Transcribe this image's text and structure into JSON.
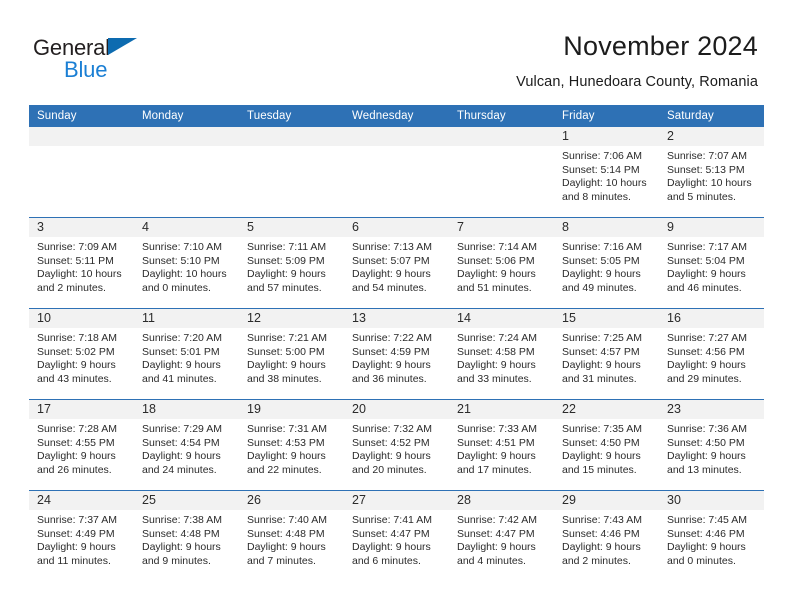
{
  "brand": {
    "name_part1": "General",
    "name_part2": "Blue",
    "triangle_color": "#0d6bb0",
    "blue_text_color": "#1b7fd4"
  },
  "header": {
    "title": "November 2024",
    "subtitle": "Vulcan, Hunedoara County, Romania"
  },
  "theme": {
    "header_blue": "#2e71b5",
    "daynum_band": "#f2f2f2",
    "text": "#2b2b2b"
  },
  "calendar": {
    "weekday_headers": [
      "Sunday",
      "Monday",
      "Tuesday",
      "Wednesday",
      "Thursday",
      "Friday",
      "Saturday"
    ],
    "weeks": [
      [
        {
          "day": "",
          "sunrise": "",
          "sunset": "",
          "daylight1": "",
          "daylight2": ""
        },
        {
          "day": "",
          "sunrise": "",
          "sunset": "",
          "daylight1": "",
          "daylight2": ""
        },
        {
          "day": "",
          "sunrise": "",
          "sunset": "",
          "daylight1": "",
          "daylight2": ""
        },
        {
          "day": "",
          "sunrise": "",
          "sunset": "",
          "daylight1": "",
          "daylight2": ""
        },
        {
          "day": "",
          "sunrise": "",
          "sunset": "",
          "daylight1": "",
          "daylight2": ""
        },
        {
          "day": "1",
          "sunrise": "Sunrise: 7:06 AM",
          "sunset": "Sunset: 5:14 PM",
          "daylight1": "Daylight: 10 hours",
          "daylight2": "and 8 minutes."
        },
        {
          "day": "2",
          "sunrise": "Sunrise: 7:07 AM",
          "sunset": "Sunset: 5:13 PM",
          "daylight1": "Daylight: 10 hours",
          "daylight2": "and 5 minutes."
        }
      ],
      [
        {
          "day": "3",
          "sunrise": "Sunrise: 7:09 AM",
          "sunset": "Sunset: 5:11 PM",
          "daylight1": "Daylight: 10 hours",
          "daylight2": "and 2 minutes."
        },
        {
          "day": "4",
          "sunrise": "Sunrise: 7:10 AM",
          "sunset": "Sunset: 5:10 PM",
          "daylight1": "Daylight: 10 hours",
          "daylight2": "and 0 minutes."
        },
        {
          "day": "5",
          "sunrise": "Sunrise: 7:11 AM",
          "sunset": "Sunset: 5:09 PM",
          "daylight1": "Daylight: 9 hours",
          "daylight2": "and 57 minutes."
        },
        {
          "day": "6",
          "sunrise": "Sunrise: 7:13 AM",
          "sunset": "Sunset: 5:07 PM",
          "daylight1": "Daylight: 9 hours",
          "daylight2": "and 54 minutes."
        },
        {
          "day": "7",
          "sunrise": "Sunrise: 7:14 AM",
          "sunset": "Sunset: 5:06 PM",
          "daylight1": "Daylight: 9 hours",
          "daylight2": "and 51 minutes."
        },
        {
          "day": "8",
          "sunrise": "Sunrise: 7:16 AM",
          "sunset": "Sunset: 5:05 PM",
          "daylight1": "Daylight: 9 hours",
          "daylight2": "and 49 minutes."
        },
        {
          "day": "9",
          "sunrise": "Sunrise: 7:17 AM",
          "sunset": "Sunset: 5:04 PM",
          "daylight1": "Daylight: 9 hours",
          "daylight2": "and 46 minutes."
        }
      ],
      [
        {
          "day": "10",
          "sunrise": "Sunrise: 7:18 AM",
          "sunset": "Sunset: 5:02 PM",
          "daylight1": "Daylight: 9 hours",
          "daylight2": "and 43 minutes."
        },
        {
          "day": "11",
          "sunrise": "Sunrise: 7:20 AM",
          "sunset": "Sunset: 5:01 PM",
          "daylight1": "Daylight: 9 hours",
          "daylight2": "and 41 minutes."
        },
        {
          "day": "12",
          "sunrise": "Sunrise: 7:21 AM",
          "sunset": "Sunset: 5:00 PM",
          "daylight1": "Daylight: 9 hours",
          "daylight2": "and 38 minutes."
        },
        {
          "day": "13",
          "sunrise": "Sunrise: 7:22 AM",
          "sunset": "Sunset: 4:59 PM",
          "daylight1": "Daylight: 9 hours",
          "daylight2": "and 36 minutes."
        },
        {
          "day": "14",
          "sunrise": "Sunrise: 7:24 AM",
          "sunset": "Sunset: 4:58 PM",
          "daylight1": "Daylight: 9 hours",
          "daylight2": "and 33 minutes."
        },
        {
          "day": "15",
          "sunrise": "Sunrise: 7:25 AM",
          "sunset": "Sunset: 4:57 PM",
          "daylight1": "Daylight: 9 hours",
          "daylight2": "and 31 minutes."
        },
        {
          "day": "16",
          "sunrise": "Sunrise: 7:27 AM",
          "sunset": "Sunset: 4:56 PM",
          "daylight1": "Daylight: 9 hours",
          "daylight2": "and 29 minutes."
        }
      ],
      [
        {
          "day": "17",
          "sunrise": "Sunrise: 7:28 AM",
          "sunset": "Sunset: 4:55 PM",
          "daylight1": "Daylight: 9 hours",
          "daylight2": "and 26 minutes."
        },
        {
          "day": "18",
          "sunrise": "Sunrise: 7:29 AM",
          "sunset": "Sunset: 4:54 PM",
          "daylight1": "Daylight: 9 hours",
          "daylight2": "and 24 minutes."
        },
        {
          "day": "19",
          "sunrise": "Sunrise: 7:31 AM",
          "sunset": "Sunset: 4:53 PM",
          "daylight1": "Daylight: 9 hours",
          "daylight2": "and 22 minutes."
        },
        {
          "day": "20",
          "sunrise": "Sunrise: 7:32 AM",
          "sunset": "Sunset: 4:52 PM",
          "daylight1": "Daylight: 9 hours",
          "daylight2": "and 20 minutes."
        },
        {
          "day": "21",
          "sunrise": "Sunrise: 7:33 AM",
          "sunset": "Sunset: 4:51 PM",
          "daylight1": "Daylight: 9 hours",
          "daylight2": "and 17 minutes."
        },
        {
          "day": "22",
          "sunrise": "Sunrise: 7:35 AM",
          "sunset": "Sunset: 4:50 PM",
          "daylight1": "Daylight: 9 hours",
          "daylight2": "and 15 minutes."
        },
        {
          "day": "23",
          "sunrise": "Sunrise: 7:36 AM",
          "sunset": "Sunset: 4:50 PM",
          "daylight1": "Daylight: 9 hours",
          "daylight2": "and 13 minutes."
        }
      ],
      [
        {
          "day": "24",
          "sunrise": "Sunrise: 7:37 AM",
          "sunset": "Sunset: 4:49 PM",
          "daylight1": "Daylight: 9 hours",
          "daylight2": "and 11 minutes."
        },
        {
          "day": "25",
          "sunrise": "Sunrise: 7:38 AM",
          "sunset": "Sunset: 4:48 PM",
          "daylight1": "Daylight: 9 hours",
          "daylight2": "and 9 minutes."
        },
        {
          "day": "26",
          "sunrise": "Sunrise: 7:40 AM",
          "sunset": "Sunset: 4:48 PM",
          "daylight1": "Daylight: 9 hours",
          "daylight2": "and 7 minutes."
        },
        {
          "day": "27",
          "sunrise": "Sunrise: 7:41 AM",
          "sunset": "Sunset: 4:47 PM",
          "daylight1": "Daylight: 9 hours",
          "daylight2": "and 6 minutes."
        },
        {
          "day": "28",
          "sunrise": "Sunrise: 7:42 AM",
          "sunset": "Sunset: 4:47 PM",
          "daylight1": "Daylight: 9 hours",
          "daylight2": "and 4 minutes."
        },
        {
          "day": "29",
          "sunrise": "Sunrise: 7:43 AM",
          "sunset": "Sunset: 4:46 PM",
          "daylight1": "Daylight: 9 hours",
          "daylight2": "and 2 minutes."
        },
        {
          "day": "30",
          "sunrise": "Sunrise: 7:45 AM",
          "sunset": "Sunset: 4:46 PM",
          "daylight1": "Daylight: 9 hours",
          "daylight2": "and 0 minutes."
        }
      ]
    ]
  }
}
